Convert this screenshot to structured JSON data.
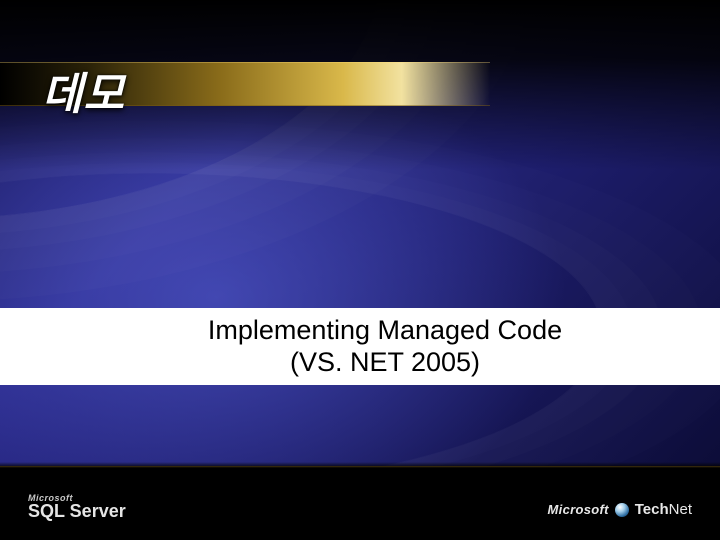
{
  "slide": {
    "title": "데모",
    "body_line1": "Implementing Managed Code",
    "body_line2": "(VS. NET 2005)"
  },
  "footer": {
    "left_small": "Microsoft",
    "left_big": "SQL Server",
    "right_brand": "Microsoft",
    "right_product_a": "Tech",
    "right_product_b": "Net"
  }
}
